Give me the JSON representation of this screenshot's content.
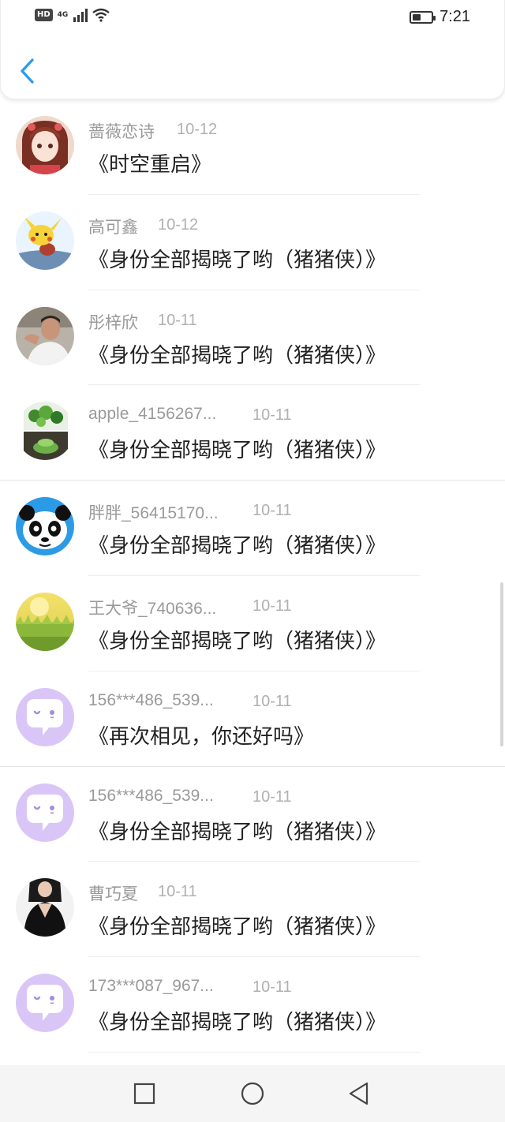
{
  "status_bar": {
    "hd_badge": "HD",
    "network": "4G",
    "signal_icon": "signal-icon",
    "wifi_icon": "wifi-icon",
    "battery_icon": "battery-icon",
    "time": "7:21"
  },
  "header": {
    "back_icon": "chevron-left-icon",
    "accent": "#2d9cf0"
  },
  "list": [
    {
      "name": "蔷薇恋诗",
      "date": "10-12",
      "title": "《时空重启》",
      "avatar": "anime-girl"
    },
    {
      "name": "高可鑫",
      "date": "10-12",
      "title": "《身份全部揭晓了哟（猪猪侠）》",
      "avatar": "pikachu"
    },
    {
      "name": "彤梓欣",
      "date": "10-11",
      "title": "《身份全部揭晓了哟（猪猪侠）》",
      "avatar": "man-photo"
    },
    {
      "name": "apple_4156267...",
      "date": "10-11",
      "title": "《身份全部揭晓了哟（猪猪侠）》",
      "avatar": "plant-photo"
    },
    {
      "name": "胖胖_56415170...",
      "date": "10-11",
      "title": "《身份全部揭晓了哟（猪猪侠）》",
      "avatar": "panda"
    },
    {
      "name": "王大爷_740636...",
      "date": "10-11",
      "title": "《身份全部揭晓了哟（猪猪侠）》",
      "avatar": "field"
    },
    {
      "name": "156***486_539...",
      "date": "10-11",
      "title": "《再次相见，你还好吗》",
      "avatar": "default-chat"
    },
    {
      "name": "156***486_539...",
      "date": "10-11",
      "title": "《身份全部揭晓了哟（猪猪侠）》",
      "avatar": "default-chat"
    },
    {
      "name": "曹巧夏",
      "date": "10-11",
      "title": "《身份全部揭晓了哟（猪猪侠）》",
      "avatar": "woman-dark"
    },
    {
      "name": "173***087_967...",
      "date": "10-11",
      "title": "《身份全部揭晓了哟（猪猪侠）》",
      "avatar": "default-chat"
    }
  ],
  "nav_bar": {
    "recents_icon": "square-icon",
    "home_icon": "circle-icon",
    "back_icon": "triangle-back-icon"
  }
}
